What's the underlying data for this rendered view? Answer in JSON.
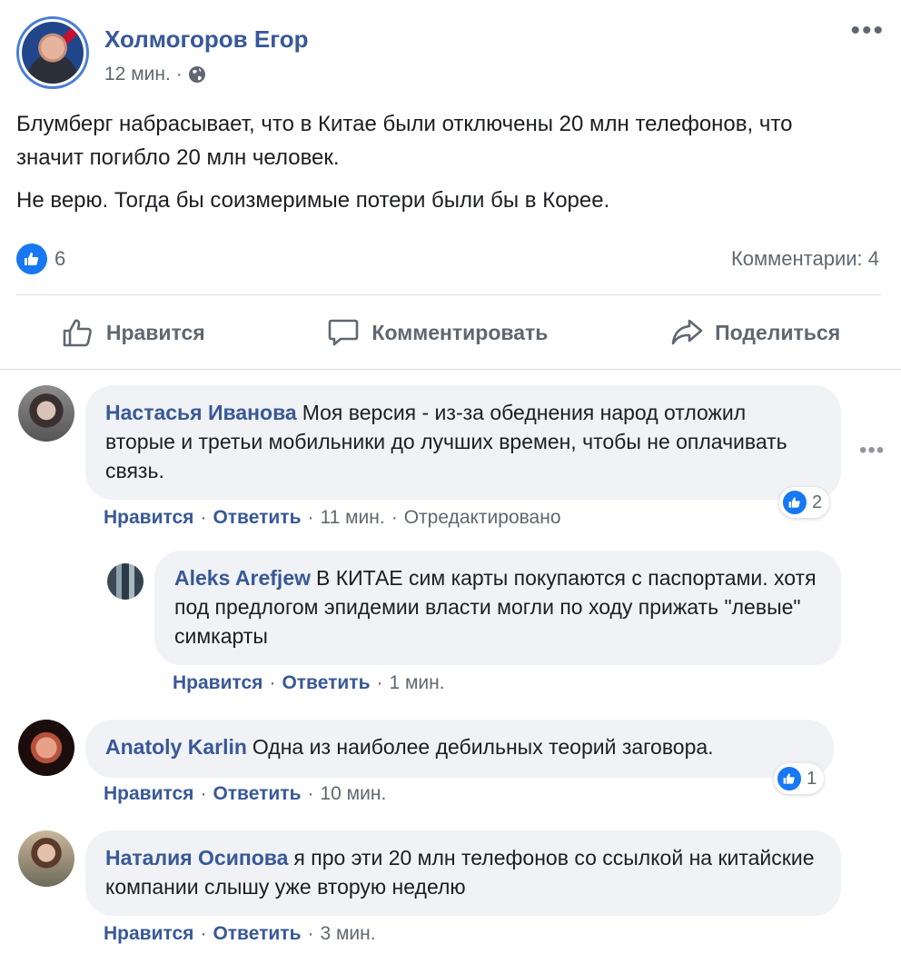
{
  "post": {
    "author": "Холмогоров Егор",
    "time": "12 мин.",
    "dot": "·",
    "more": "•••",
    "paragraph1": "Блумберг набрасывает, что в Китае были отключены 20 млн телефонов, что значит погибло 20 млн человек.",
    "paragraph2": "Не верю. Тогда бы соизмеримые потери были бы в Корее.",
    "likes": "6",
    "comments_count": "Комментарии: 4"
  },
  "actions": {
    "like": "Нравится",
    "comment": "Комментировать",
    "share": "Поделиться"
  },
  "comments": [
    {
      "author": "Настасья Иванова",
      "text": "Моя версия - из-за обеднения народ отложил вторые и третьи мобильники до лучших времен, чтобы не оплачивать связь.",
      "like": "Нравится",
      "reply": "Ответить",
      "time": "11 мин.",
      "edited": "Отредактировано",
      "reactions": "2",
      "more": "•••"
    },
    {
      "author": "Aleks Arefjew",
      "text": "В КИТАЕ сим карты покупаются с паспортами. хотя под предлогом эпидемии власти могли по ходу прижать \"левые\" симкарты",
      "like": "Нравится",
      "reply": "Ответить",
      "time": "1 мин."
    },
    {
      "author": "Anatoly Karlin",
      "text": "Одна из наиболее дебильных теорий заговора.",
      "like": "Нравится",
      "reply": "Ответить",
      "time": "10 мин.",
      "reactions": "1"
    },
    {
      "author": "Наталия Осипова",
      "text": "я про эти 20 млн телефонов со ссылкой на китайские компании слышу уже вторую неделю",
      "like": "Нравится",
      "reply": "Ответить",
      "time": "3 мин."
    }
  ],
  "separator": "·",
  "colors": {
    "link": "#385898",
    "secondary": "#606770",
    "bubble": "#f0f2f5",
    "like_blue": "#1877f2"
  }
}
